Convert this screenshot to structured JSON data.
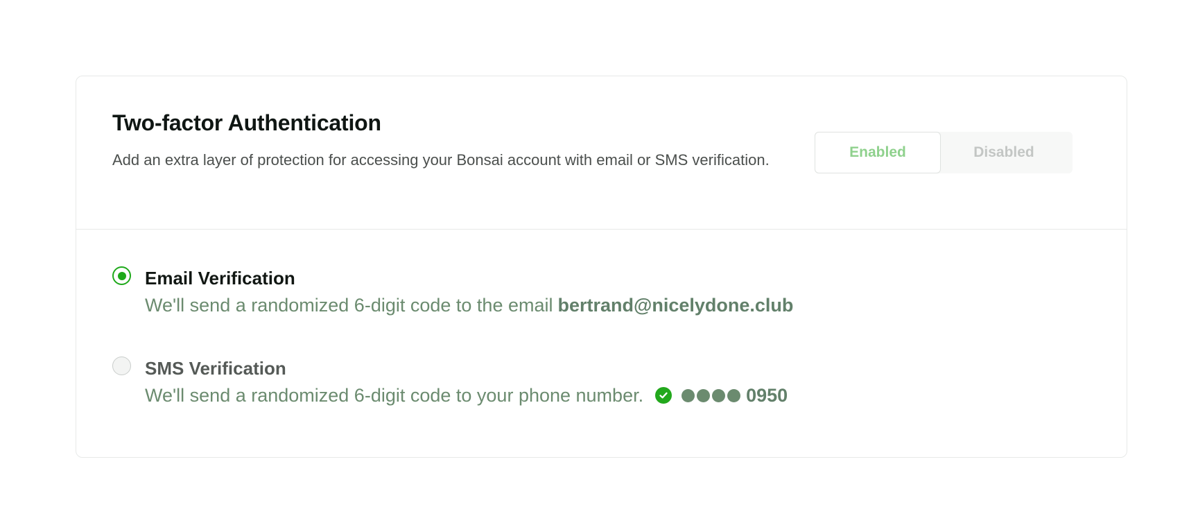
{
  "header": {
    "title": "Two-factor Authentication",
    "description": "Add an extra layer of protection for accessing your Bonsai account with email or SMS verification."
  },
  "toggle": {
    "options": [
      "Enabled",
      "Disabled"
    ],
    "selected": "Enabled"
  },
  "email_option": {
    "label": "Email Verification",
    "text": "We'll send a randomized 6-digit code to the email",
    "email": "bertrand@nicelydone.club",
    "selected": true
  },
  "sms_option": {
    "label": "SMS Verification",
    "text": "We'll send a randomized 6-digit code to your phone number.",
    "masked_digits": "●●●●",
    "last_digits": "0950",
    "verified_icon": "check-circle-icon",
    "selected": false
  },
  "colors": {
    "accent_green": "#1ea91a",
    "muted_green_text": "#6b8b6f",
    "enabled_text": "#8fd18d",
    "disabled_text": "#c3c6c4"
  }
}
